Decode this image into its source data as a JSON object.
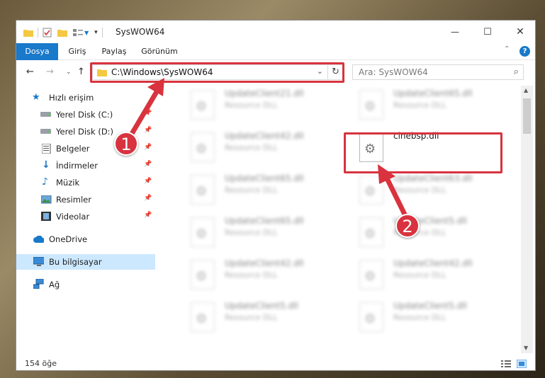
{
  "window": {
    "title": "SysWOW64",
    "controls": {
      "minimize": "—",
      "maximize": "☐",
      "close": "✕"
    },
    "help_icon": "?",
    "expand_ribbon_icon": "⌃"
  },
  "ribbon": {
    "tabs": [
      "Dosya",
      "Giriş",
      "Paylaş",
      "Görünüm"
    ]
  },
  "address": {
    "path": "C:\\Windows\\SysWOW64",
    "search_placeholder": "Ara: SysWOW64"
  },
  "nav": {
    "items": [
      {
        "label": "Hızlı erişim",
        "icon": "star-icon",
        "pinned": false
      },
      {
        "label": "Yerel Disk (C:)",
        "icon": "drive-icon",
        "pinned": true
      },
      {
        "label": "Yerel Disk (D:)",
        "icon": "drive-icon",
        "pinned": true
      },
      {
        "label": "Belgeler",
        "icon": "documents-icon",
        "pinned": true
      },
      {
        "label": "İndirmeler",
        "icon": "download-icon",
        "pinned": true
      },
      {
        "label": "Müzik",
        "icon": "music-icon",
        "pinned": true
      },
      {
        "label": "Resimler",
        "icon": "pictures-icon",
        "pinned": true
      },
      {
        "label": "Videolar",
        "icon": "videos-icon",
        "pinned": true
      },
      {
        "label": "OneDrive",
        "icon": "cloud-icon",
        "pinned": false
      },
      {
        "label": "Bu bilgisayar",
        "icon": "computer-icon",
        "pinned": false,
        "selected": true
      },
      {
        "label": "Ağ",
        "icon": "network-icon",
        "pinned": false
      }
    ]
  },
  "files": {
    "highlighted": {
      "name": "cinebsp.dll",
      "type": ""
    },
    "blurred": [
      {
        "name": "UpdateClient21.dll",
        "type": "Resource DLL"
      },
      {
        "name": "UpdateClient65.dll",
        "type": "Resource DLL"
      },
      {
        "name": "UpdateClient42.dll",
        "type": "Resource DLL"
      },
      {
        "name": "UpdateClient65.dll",
        "type": "Resource DLL"
      },
      {
        "name": "UpdateClient63.dll",
        "type": "Resource DLL"
      },
      {
        "name": "UpdateClient65.dll",
        "type": "Resource DLL"
      },
      {
        "name": "UpdateClient5.dll",
        "type": "Resource DLL"
      },
      {
        "name": "UpdateClient42.dll",
        "type": "Resource DLL"
      },
      {
        "name": "UpdateClient42.dll",
        "type": "Resource DLL"
      },
      {
        "name": "UpdateClient5.dll",
        "type": "Resource DLL"
      },
      {
        "name": "UpdateClient5.dll",
        "type": "Resource DLL"
      }
    ]
  },
  "status": {
    "item_count": "154 öğe"
  },
  "annotations": {
    "step1": "1",
    "step2": "2",
    "highlight_color": "#d8333e"
  }
}
